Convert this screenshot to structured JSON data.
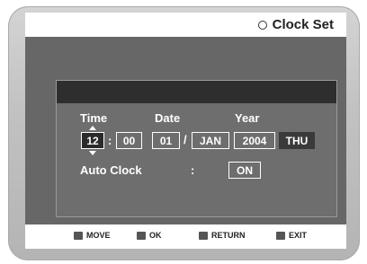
{
  "header": {
    "title": "Clock Set",
    "title_icon": "circle-icon"
  },
  "labels": {
    "time": "Time",
    "date": "Date",
    "year": "Year",
    "auto_clock": "Auto Clock",
    "colon": ":"
  },
  "values": {
    "hour": "12",
    "minute": "00",
    "day": "01",
    "month": "JAN",
    "year": "2004",
    "weekday": "THU",
    "auto_clock": "ON"
  },
  "separators": {
    "time": ":",
    "date": "/"
  },
  "footer": {
    "items": [
      {
        "label": "MOVE",
        "icon": "updown-icon"
      },
      {
        "label": "OK",
        "icon": "enter-icon"
      },
      {
        "label": "RETURN",
        "icon": "return-icon"
      },
      {
        "label": "EXIT",
        "icon": "exit-icon"
      }
    ]
  },
  "colors": {
    "screen": "#676767",
    "panel_header": "#2e2e2e",
    "selected": "#2b2b2b",
    "text": "#ffffff"
  }
}
